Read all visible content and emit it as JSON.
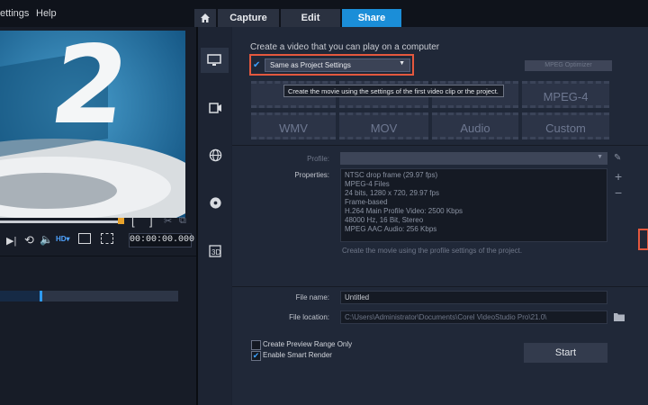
{
  "menu": {
    "settings": "ettings",
    "help": "Help"
  },
  "tabs": {
    "home_icon": "home-icon",
    "capture": "Capture",
    "edit": "Edit",
    "share": "Share"
  },
  "preview": {
    "number": "2",
    "timecode": "00:00:00.000"
  },
  "share": {
    "heading": "Create a video that you can play on a computer",
    "dropdown_value": "Same as Project Settings",
    "mpeg_optimizer": "MPEG Optimizer",
    "tooltip": "Create the movie using the settings of the first video clip or the project.",
    "formats": [
      "MPEG-4",
      "WMV",
      "MOV",
      "Audio",
      "Custom"
    ],
    "profile_label": "Profile:",
    "properties_label": "Properties:",
    "properties": [
      "NTSC drop frame (29.97 fps)",
      "MPEG-4 Files",
      "24 bits, 1280 x 720, 29.97 fps",
      "Frame-based",
      "H.264 Main Profile Video: 2500 Kbps",
      "48000 Hz, 16 Bit, Stereo",
      "MPEG AAC Audio: 256 Kbps"
    ],
    "description": "Create the movie using the profile settings of the project.",
    "file_name_label": "File name:",
    "file_name": "Untitled",
    "file_location_label": "File location:",
    "file_location": "C:\\Users\\Administrator\\Documents\\Corel VideoStudio Pro\\21.0\\",
    "preview_range": "Create Preview Range Only",
    "smart_render": "Enable Smart Render",
    "start": "Start"
  }
}
